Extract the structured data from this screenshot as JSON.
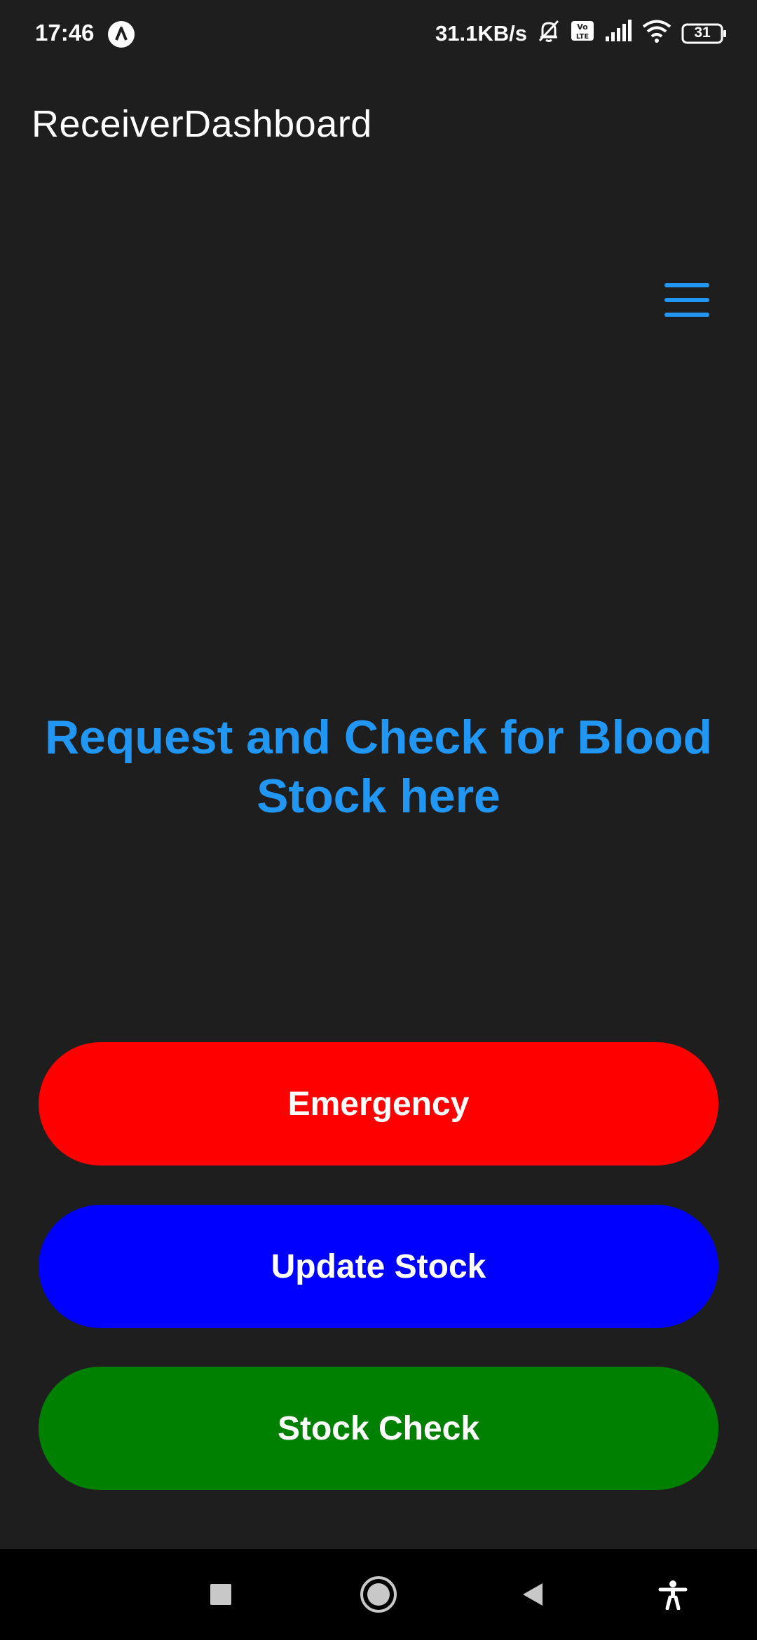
{
  "status_bar": {
    "time": "17:46",
    "net_speed": "31.1KB/s",
    "battery": "31",
    "icons": [
      "app-notification-icon",
      "mute-bell-icon",
      "volte-icon",
      "signal-icon",
      "wifi-icon",
      "battery-icon"
    ]
  },
  "app_bar": {
    "title": "ReceiverDashboard",
    "menu_icon": "hamburger-menu-icon"
  },
  "main": {
    "headline": "Request and Check for Blood Stock here",
    "buttons": [
      {
        "label": "Emergency",
        "color": "#ff0000"
      },
      {
        "label": "Update Stock",
        "color": "#0000ff"
      },
      {
        "label": "Stock Check",
        "color": "#008000"
      }
    ]
  },
  "nav_bar": {
    "icons": [
      "recents-square-icon",
      "home-circle-icon",
      "back-triangle-icon",
      "accessibility-icon"
    ]
  },
  "colors": {
    "background": "#1e1e1f",
    "accent": "#2196f3"
  }
}
